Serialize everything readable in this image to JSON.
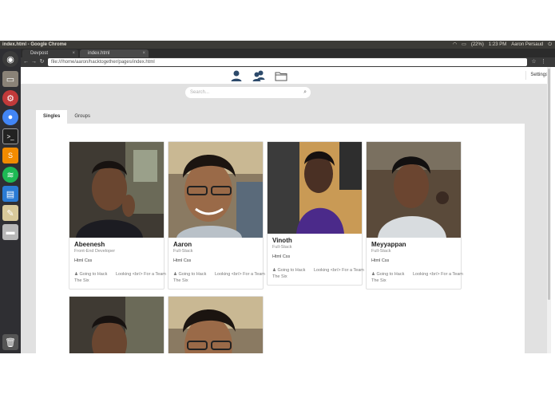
{
  "os_bar": {
    "window_title": "index.html - Google Chrome",
    "battery": "(22%)",
    "time": "1:23 PM",
    "user": "Aaron Persaud"
  },
  "browser": {
    "tabs": [
      {
        "label": "Devpost"
      },
      {
        "label": "index.html"
      }
    ],
    "url": "file:///home/aaron/hacktogether/pages/index.html"
  },
  "header": {
    "settings_label": "Settings"
  },
  "search": {
    "placeholder": "Search..."
  },
  "page_tabs": [
    {
      "label": "Singles",
      "active": true
    },
    {
      "label": "Groups",
      "active": false
    }
  ],
  "cards": [
    {
      "name": "Abeenesh",
      "role": "Front-End Developer",
      "skills": "Html Css",
      "going": "Going to Hack The Six",
      "looking": "Looking <br/> For a Team"
    },
    {
      "name": "Aaron",
      "role": "Full-Stack",
      "skills": "Html Css",
      "going": "Going to Hack The Six",
      "looking": "Looking <br/> For a Team"
    },
    {
      "name": "Vinoth",
      "role": "Full-Stack",
      "skills": "Html Css",
      "going": "Going to Hack The Six",
      "looking": "Looking <br/> For a Team"
    },
    {
      "name": "Meyyappan",
      "role": "Full-Stack",
      "skills": "Html Css",
      "going": "Going to Hack The Six",
      "looking": "Looking <br/> For a Team"
    }
  ],
  "colors": {
    "header_icon": "#2d4a6b",
    "background_grey": "#e1e1e1",
    "launcher": "#2f2f33"
  }
}
